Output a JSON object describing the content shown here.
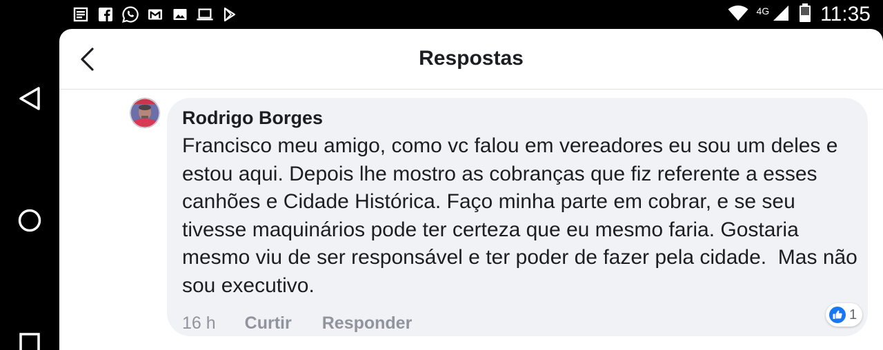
{
  "status_bar": {
    "notification_icons": [
      "news-icon",
      "facebook-icon",
      "whatsapp-icon",
      "gmail-icon",
      "gallery-icon",
      "laptop-icon",
      "play-store-icon"
    ],
    "network": "4G",
    "time": "11:35"
  },
  "header": {
    "title": "Respostas"
  },
  "comment": {
    "author": "Rodrigo Borges",
    "text": "Francisco meu amigo, como vc falou em vereadores eu sou um deles e estou aqui. Depois lhe mostro as cobranças que fiz referente a esses canhões e Cidade Histórica. Faço minha parte em cobrar, e se seu tivesse maquinários pode ter certeza que eu mesmo faria. Gostaria mesmo viu de ser responsável e ter poder de fazer pela cidade.  Mas não sou executivo.",
    "time": "16 h",
    "like_label": "Curtir",
    "reply_label": "Responder",
    "like_count": "1"
  },
  "colors": {
    "accent": "#1877f2",
    "bubble": "#f0f2f5",
    "muted_text": "#90949c"
  }
}
